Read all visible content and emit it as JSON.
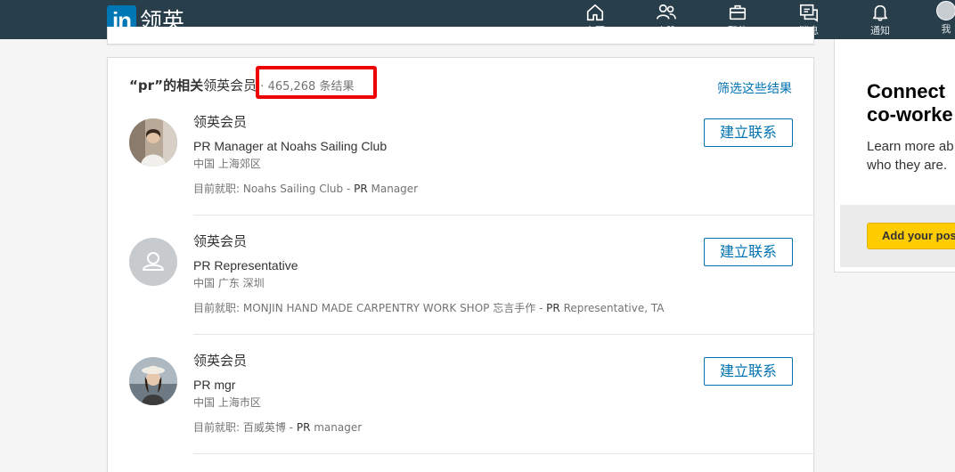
{
  "nav": {
    "logo_mark": "in",
    "logo_text": "领英",
    "items": [
      {
        "label": "主页",
        "icon": "home-icon"
      },
      {
        "label": "人脉",
        "icon": "network-icon"
      },
      {
        "label": "职位",
        "icon": "briefcase-icon"
      },
      {
        "label": "消息",
        "icon": "messaging-icon"
      },
      {
        "label": "通知",
        "icon": "bell-icon"
      },
      {
        "label": "我",
        "icon": "avatar"
      }
    ]
  },
  "results": {
    "query": "“pr”的相关",
    "member_label": "领英会员",
    "separator": " · ",
    "count_text": "465,268 条结果",
    "filter_link": "筛选这些结果",
    "items": [
      {
        "name": "领英会员",
        "headline": "PR Manager at Noahs Sailing Club",
        "location": "中国 上海郊区",
        "current_prefix": "目前就职: Noahs Sailing Club - ",
        "current_role_pr": "PR",
        "current_role_rest": " Manager",
        "connect_label": "建立联系",
        "avatar": "photo"
      },
      {
        "name": "领英会员",
        "headline": "PR Representative",
        "location": "中国 广东 深圳",
        "current_prefix": "目前就职: MONJIN HAND MADE CARPENTRY WORK SHOP 忘言手作 - ",
        "current_role_pr": "PR",
        "current_role_rest": " Representative, TA",
        "connect_label": "建立联系",
        "avatar": "placeholder"
      },
      {
        "name": "领英会员",
        "headline": "PR mgr",
        "location": "中国 上海市区",
        "current_prefix": "目前就职: 百威英博 - ",
        "current_role_pr": "PR",
        "current_role_rest": " manager",
        "connect_label": "建立联系",
        "avatar": "photo"
      }
    ]
  },
  "ad": {
    "title_line1": "Connect",
    "title_line2": "co-worke",
    "sub_line1": "Learn more ab",
    "sub_line2": "who they are.",
    "button": "Add your pos"
  },
  "colors": {
    "nav_bg": "#283e4a",
    "brand_blue": "#0077b5",
    "link_blue": "#0073b1",
    "highlight_red": "#ee0000",
    "ad_button": "#ffcc00"
  }
}
